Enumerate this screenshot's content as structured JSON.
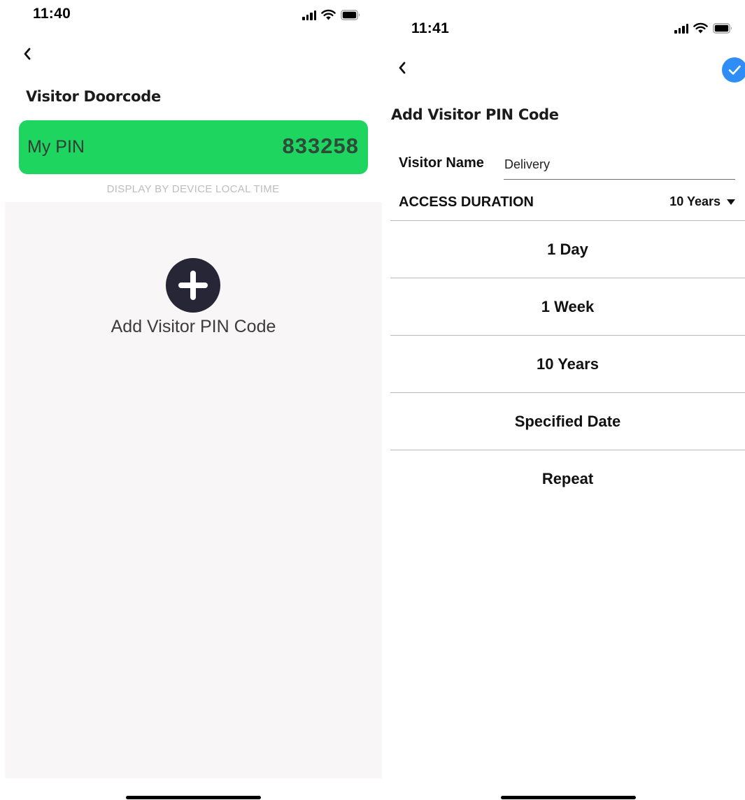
{
  "left_screen": {
    "status_time": "11:40",
    "title": "Visitor Doorcode",
    "pin_card": {
      "label": "My PIN",
      "value": "833258",
      "color": "#1ed65f"
    },
    "note": "DISPLAY BY DEVICE LOCAL TIME",
    "add_label": "Add Visitor PIN Code"
  },
  "right_screen": {
    "status_time": "11:41",
    "title": "Add Visitor PIN Code",
    "visitor_name_label": "Visitor Name",
    "visitor_name_value": "Delivery",
    "access_duration_label": "ACCESS DURATION",
    "access_duration_value": "10 Years",
    "options": [
      "1 Day",
      "1 Week",
      "10 Years",
      "Specified Date",
      "Repeat"
    ],
    "accent_color": "#2f8ef5"
  },
  "icons": {
    "status": [
      "signal-icon",
      "wifi-icon",
      "battery-icon"
    ],
    "back": "chevron-left-icon",
    "add": "plus-circle-icon",
    "confirm": "checkmark-icon",
    "dropdown": "caret-down-icon"
  }
}
